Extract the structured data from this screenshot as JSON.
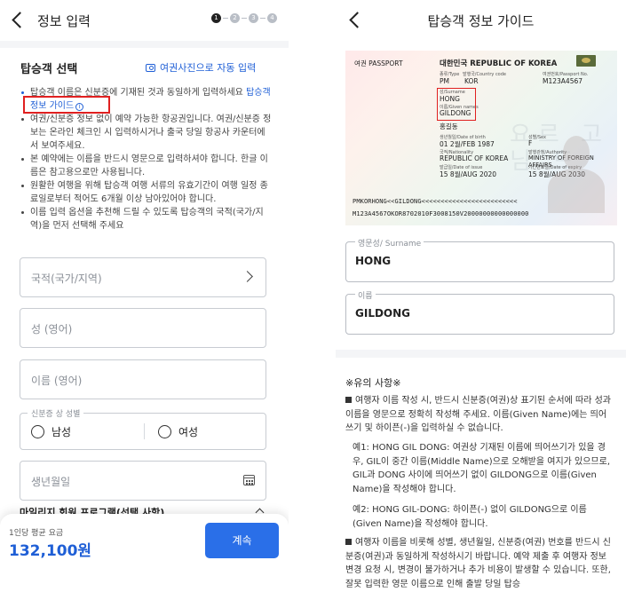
{
  "left": {
    "header": {
      "title": "정보 입력",
      "steps": [
        "1",
        "2",
        "3",
        "4"
      ]
    },
    "section_title": "탑승객 선택",
    "auto_fill_link": "여권사진으로 자동 입력",
    "notes": {
      "n1_text": "탑승객 이름은 신분증에 기재된 것과 동일하게 입력하세요 ",
      "n1_link": "탑승객 정보 가이드",
      "n1_info_icon": "ⓘ",
      "n2": "여권/신분증 정보 없이 예약 가능한 항공권입니다. 여권/신분증 정보는 온라인 체크인 시 입력하시거나 출국 당일 항공사 카운터에서 보여주세요.",
      "n3": "본 예약에는 이름을 반드시 영문으로 입력하셔야 합니다. 한글 이름은 참고용으로만 사용됩니다.",
      "n4": "원활한 여행을 위해 탑승객 여행 서류의 유효기간이 여행 일정 종료일로부터 적어도 6개월 이상 남아있어야 합니다.",
      "n5": "이름 입력 옵션을 추천해 드릴 수 있도록 탑승객의 국적(국가/지역)을 먼저 선택해 주세요"
    },
    "fields": {
      "nationality": "국적(국가/지역)",
      "surname": "성 (영어)",
      "given_name": "이름 (영어)",
      "gender_legend": "신분증 상 성별",
      "male": "남성",
      "female": "여성",
      "birthdate": "생년월일"
    },
    "mileage_program": "마일리지 회원 프로그램(선택 사항)",
    "bottom": {
      "avg_label": "1인당 평균 요금",
      "price": "132,100원",
      "continue": "계속"
    },
    "colors": {
      "accent": "#1f5fd6",
      "button": "#2a6fe8",
      "highlight": "#e02020"
    }
  },
  "right": {
    "header": {
      "title": "탑승객 정보 가이드"
    },
    "passport": {
      "type_label": "여권 PASSPORT",
      "country": "대한민국  REPUBLIC OF KOREA",
      "type_code_lbl": "종류/Type",
      "type_code": "PM",
      "issuing_lbl": "발행국/Country code",
      "issuing": "KOR",
      "number_lbl": "여권번호/Passport No.",
      "number": "M123A4567",
      "surname_lbl": "성/Surname",
      "surname": "HONG",
      "given_lbl": "이름/Given names",
      "given": "GILDONG",
      "korean_name": "홍길동",
      "dob_lbl": "생년월일/Date of birth",
      "dob": "01 2월/FEB 1987",
      "sex_lbl": "성별/Sex",
      "sex": "F",
      "nationality_lbl": "국적/Nationality",
      "nationality": "REPUBLIC OF KOREA",
      "authority_lbl": "발행관청/Authority",
      "authority": "MINISTRY OF FOREIGN AFFAIRS",
      "issue_lbl": "발급일/Date of issue",
      "issue": "15 8월/AUG 2020",
      "expiry_lbl": "기간만료일/Date of expiry",
      "expiry": "15 8월/AUG 2030",
      "watermark": "요르 고 님 드",
      "mrz1": "PMKORHONG<<GILDONG<<<<<<<<<<<<<<<<<<<<<<<<<",
      "mrz2": "M123A4567OKOR8702010F3008150V20000000000000000"
    },
    "surname_field": {
      "legend": "영문성/ Surname",
      "value": "HONG"
    },
    "given_field": {
      "legend": "이름",
      "value": "GILDONG"
    },
    "caution_title": "※유의 사항※",
    "p1": "여행자 이름 작성 시, 반드시 신분증(여권)상 표기된 순서에 따라 성과 이름을 영문으로 정확히 작성해 주세요. 이름(Given Name)에는 띄어쓰기 및 하이픈(-)을 입력하실 수 없습니다.",
    "ex1": "예1: HONG GIL DONG: 여권상 기재된 이름에 띄어쓰기가 있을 경우, GIL이 중간 이름(Middle Name)으로 오해받을 여지가 있으므로, GIL과 DONG 사이에 띄어쓰기 없이 GILDONG으로 이름(Given Name)을 작성해야 합니다.",
    "ex2": "예2: HONG GIL-DONG: 하이픈(-) 없이 GILDONG으로 이름(Given Name)을 작성해야 합니다.",
    "p2": "여행자 이름을 비롯해 성별, 생년월일, 신분증(여권) 번호를 반드시 신분증(여권)과 동일하게 작성하시기 바랍니다. 예약 제출 후 여행자 정보 변경 요청 시, 변경이 불가하거나 추가 비용이 발생할 수 있습니다. 또한, 잘못 입력한 영문 이름으로 인해 출발 당일 탑승"
  }
}
